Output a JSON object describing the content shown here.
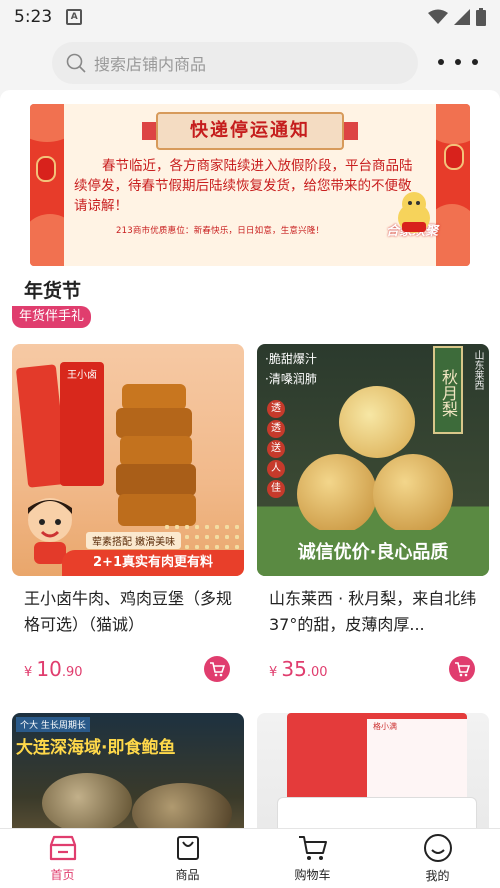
{
  "status_bar": {
    "time": "5:23"
  },
  "search": {
    "placeholder": "搜索店铺内商品"
  },
  "banner": {
    "title": "快递停运通知",
    "body": "春节临近，各方商家陆续进入放假阶段，平台商品陆续停发，待春节假期后陆续恢复发货，给您带来的不便敬请谅解！",
    "subtitle": "213商市优质惠位：新春快乐，日日如意，生意兴隆！",
    "logo": "合家欢聚"
  },
  "section": {
    "title": "年货节",
    "tag": "年货伴手礼"
  },
  "products": [
    {
      "name": "王小卤牛肉、鸡肉豆堡（多规格可选）（猫诚）",
      "price_symbol": "¥",
      "price_int": "10",
      "price_dec": ".90",
      "image_caption_1": "荤素搭配 嫩滑美味",
      "image_caption_2": "2+1真实有肉更有料",
      "brand_label": "王小卤"
    },
    {
      "name": "山东莱西 · 秋月梨，来自北纬37°的甜，皮薄肉厚...",
      "price_symbol": "¥",
      "price_int": "35",
      "price_dec": ".00",
      "image_caption_1": "·脆甜爆汁",
      "image_caption_2": "·清嗓润肺",
      "image_caption_3": "诚信优价·良心品质",
      "vertical_label": "秋月梨",
      "region_label": "山东莱西",
      "circle_labels": [
        "透",
        "透",
        "送",
        "人",
        "佳"
      ]
    },
    {
      "name": "",
      "image_caption_1": "大连深海域·即食鲍鱼",
      "image_caption_2": "个大 生长周期长"
    },
    {
      "name": "",
      "image_caption_1": "格小满"
    }
  ],
  "tabbar": {
    "items": [
      {
        "label": "首页",
        "icon": "home-icon"
      },
      {
        "label": "商品",
        "icon": "bag-icon"
      },
      {
        "label": "购物车",
        "icon": "cart-icon"
      },
      {
        "label": "我的",
        "icon": "smile-icon"
      }
    ]
  },
  "colors": {
    "accent": "#e03d6e",
    "banner_red": "#e73c2a",
    "bg": "#f4f4f4"
  }
}
